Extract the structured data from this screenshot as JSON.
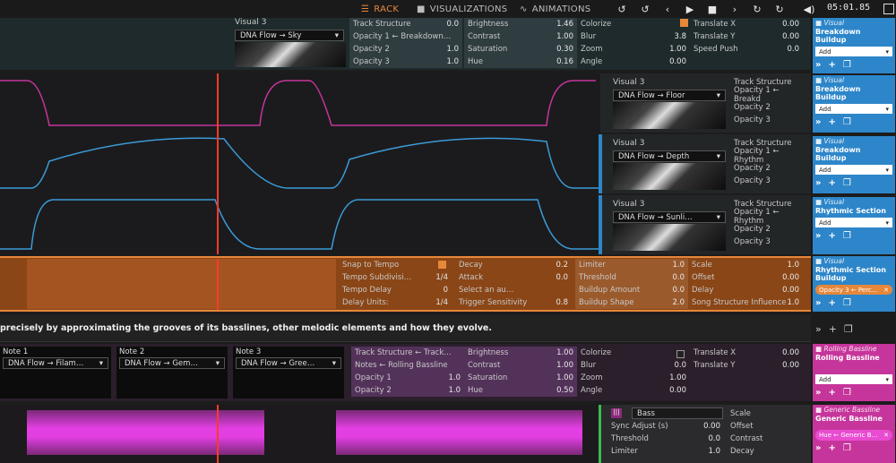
{
  "topbar": {
    "rack": "RACK",
    "visualizations": "VISUALIZATIONS",
    "animations": "ANIMATIONS",
    "time": "05:01.85"
  },
  "t1": {
    "visual_label": "Visual 3",
    "selector": "DNA Flow → Sky",
    "c1": [
      [
        "Track Structure",
        "0.0"
      ],
      [
        "Opacity 1 ← Breakdown…",
        ""
      ],
      [
        "Opacity 2",
        "1.0"
      ],
      [
        "Opacity 3",
        "1.0"
      ]
    ],
    "c2": [
      [
        "Brightness",
        "1.46"
      ],
      [
        "Contrast",
        "1.00"
      ],
      [
        "Saturation",
        "0.30"
      ],
      [
        "Hue",
        "0.16"
      ]
    ],
    "c3": [
      [
        "Colorize",
        ""
      ],
      [
        "Blur",
        "3.8"
      ],
      [
        "Zoom",
        "1.00"
      ],
      [
        "Angle",
        "0.00"
      ]
    ],
    "c4": [
      [
        "Translate X",
        "0.00"
      ],
      [
        "Translate Y",
        "0.00"
      ],
      [
        "Speed Push",
        "0.0"
      ]
    ],
    "side": {
      "kind": "Visual",
      "title": "Breakdown Buildup",
      "add": "Add"
    }
  },
  "t2": {
    "visual_label": "Visual 3",
    "selector": "DNA Flow → Floor",
    "params": [
      "Track Structure",
      "Opacity 1 ← Breakd",
      "Opacity 2",
      "Opacity 3"
    ],
    "side": {
      "kind": "Visual",
      "title": "Breakdown Buildup",
      "add": "Add"
    }
  },
  "t3": {
    "visual_label": "Visual 3",
    "selector": "DNA Flow → Depth",
    "params": [
      "Track Structure",
      "Opacity 1 ← Rhythm",
      "Opacity 2",
      "Opacity 3"
    ],
    "side": {
      "kind": "Visual",
      "title": "Breakdown Buildup",
      "add": "Add"
    }
  },
  "t4": {
    "visual_label": "Visual 3",
    "selector": "DNA Flow → Sunli…",
    "params": [
      "Track Structure",
      "Opacity 1 ← Rhythm",
      "Opacity 2",
      "Opacity 3"
    ],
    "side": {
      "kind": "Visual",
      "title": "Rhythmic Section",
      "add": "Add"
    }
  },
  "t5": {
    "c1": [
      [
        "Snap to Tempo",
        ""
      ],
      [
        "Tempo Subdivisi…",
        "1/4"
      ],
      [
        "Tempo Delay",
        "0"
      ],
      [
        "Delay Units:",
        "1/4"
      ]
    ],
    "c2": [
      [
        "Decay",
        "0.2"
      ],
      [
        "Attack",
        "0.0"
      ],
      [
        "Select an au…",
        ""
      ],
      [
        "Trigger Sensitivity",
        "0.8"
      ]
    ],
    "c3": [
      [
        "Limiter",
        "1.0"
      ],
      [
        "Threshold",
        "0.0"
      ],
      [
        "Buildup Amount",
        "0.0"
      ],
      [
        "Buildup Shape",
        "2.0"
      ]
    ],
    "c4": [
      [
        "Scale",
        "1.0"
      ],
      [
        "Offset",
        "0.00"
      ],
      [
        "Delay",
        "0.00"
      ],
      [
        "Song Structure Influence",
        "1.0"
      ]
    ],
    "side": {
      "kind": "Visual",
      "title": "Rhythmic Section Buildup",
      "chip": "Opacity 3 ← Perc…"
    }
  },
  "banner": "precisely by approximating the grooves of its basslines, other melodic elements and how they evolve.",
  "t6": {
    "notes": [
      [
        "Note 1",
        "DNA Flow → Filam…"
      ],
      [
        "Note 2",
        "DNA Flow → Gem…"
      ],
      [
        "Note 3",
        "DNA Flow → Gree…"
      ]
    ],
    "c1": [
      [
        "Track Structure ← Track…",
        ""
      ],
      [
        "Notes ← Rolling Bassline",
        ""
      ],
      [
        "Opacity 1",
        "1.0"
      ],
      [
        "Opacity 2",
        "1.0"
      ]
    ],
    "c2": [
      [
        "Brightness",
        "1.00"
      ],
      [
        "Contrast",
        "1.00"
      ],
      [
        "Saturation",
        "1.00"
      ],
      [
        "Hue",
        "0.50"
      ]
    ],
    "c3": [
      [
        "Colorize",
        ""
      ],
      [
        "Blur",
        "0.0"
      ],
      [
        "Zoom",
        "1.00"
      ],
      [
        "Angle",
        "0.00"
      ]
    ],
    "c4": [
      [
        "Translate X",
        "0.00"
      ],
      [
        "Translate Y",
        "0.00"
      ]
    ],
    "side": {
      "kind": "Rolling Bassline",
      "title": "Rolling Bassline",
      "add": "Add"
    }
  },
  "t7": {
    "band": "Bass",
    "c1": [
      [
        "Sync Adjust (s)",
        "0.00"
      ],
      [
        "Threshold",
        "0.0"
      ],
      [
        "Limiter",
        "1.0"
      ]
    ],
    "c2": [
      "Scale",
      "Offset",
      "Contrast",
      "Decay"
    ],
    "side": {
      "kind": "Generic Bassline",
      "title": "Generic Bassline",
      "chip": "Hue ← Generic B…"
    }
  },
  "colors": {
    "orange": "#e7873a",
    "blue": "#2d86c9",
    "magenta": "#c6359b",
    "red": "#ff3a2a"
  }
}
